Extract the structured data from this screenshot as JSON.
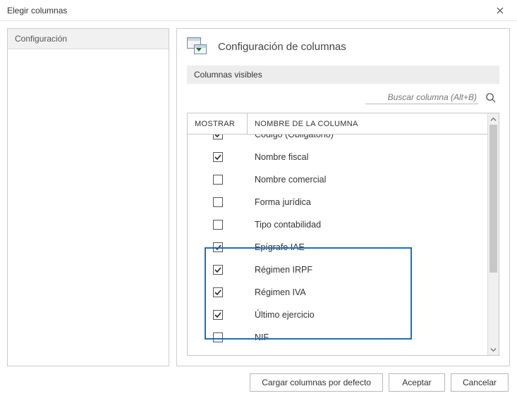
{
  "window": {
    "title": "Elegir columnas"
  },
  "sidebar": {
    "items": [
      {
        "label": "Configuración"
      }
    ]
  },
  "main": {
    "title": "Configuración de columnas",
    "section_label": "Columnas visibles",
    "search": {
      "placeholder": "Buscar columna (Alt+B)"
    }
  },
  "table": {
    "headers": {
      "mostrar": "MOSTRAR",
      "nombre": "NOMBRE DE LA COLUMNA"
    },
    "rows": [
      {
        "checked": true,
        "label": "Código (Obligatorio)"
      },
      {
        "checked": true,
        "label": "Nombre fiscal"
      },
      {
        "checked": false,
        "label": "Nombre comercial"
      },
      {
        "checked": false,
        "label": "Forma jurídica"
      },
      {
        "checked": false,
        "label": "Tipo contabilidad"
      },
      {
        "checked": true,
        "label": "Epígrafe IAE"
      },
      {
        "checked": true,
        "label": "Régimen IRPF"
      },
      {
        "checked": true,
        "label": "Régimen IVA"
      },
      {
        "checked": true,
        "label": "Último ejercicio"
      },
      {
        "checked": false,
        "label": "NIF"
      }
    ]
  },
  "footer": {
    "load_defaults": "Cargar columnas por defecto",
    "accept": "Aceptar",
    "cancel": "Cancelar"
  }
}
